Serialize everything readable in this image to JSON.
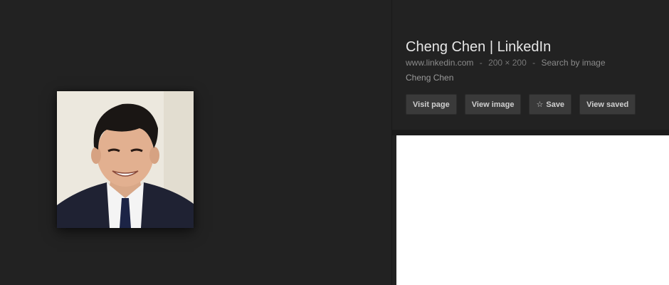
{
  "result": {
    "title": "Cheng Chen | LinkedIn",
    "source": "www.linkedin.com",
    "separator": "-",
    "dimensions": "200 × 200",
    "search_by_image": "Search by image",
    "caption": "Cheng Chen"
  },
  "actions": {
    "visit_page": "Visit page",
    "view_image": "View image",
    "save": "Save",
    "save_icon": "star-icon",
    "view_saved": "View saved"
  },
  "colors": {
    "background": "#222222",
    "title": "#e6e6e6",
    "button": "#3a3a3a",
    "related_panel": "#ffffff"
  }
}
